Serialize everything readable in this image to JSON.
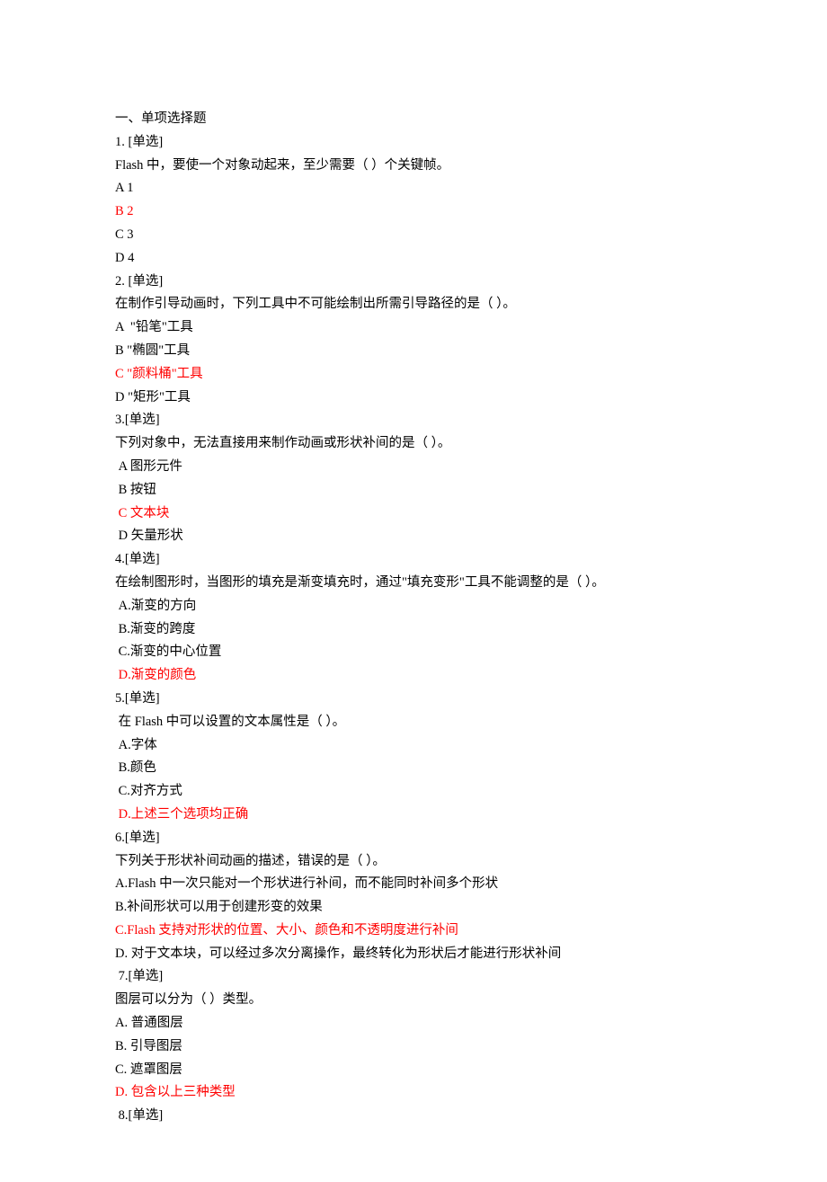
{
  "section_title": "一、单项选择题",
  "q1": {
    "num": "1. [单选]",
    "stem": "Flash 中，要使一个对象动起来，至少需要（ ）个关键帧。",
    "a": "A 1",
    "b": "B 2",
    "c": "C 3",
    "d": "D 4"
  },
  "q2": {
    "num": "2. [单选]",
    "stem": "在制作引导动画时，下列工具中不可能绘制出所需引导路径的是（ ）。",
    "a": "A  \"铅笔\"工具",
    "b": "B \"椭圆\"工具",
    "c": "C \"颜料桶\"工具",
    "d": "D \"矩形\"工具"
  },
  "q3": {
    "num": "3.[单选]",
    "stem": "下列对象中，无法直接用来制作动画或形状补间的是（ ）。",
    "a": " A 图形元件",
    "b": " B 按钮",
    "c": " C 文本块",
    "d": " D 矢量形状"
  },
  "q4": {
    "num": "4.[单选]",
    "stem": "在绘制图形时，当图形的填充是渐变填充时，通过\"填充变形\"工具不能调整的是（ ）。",
    "a": " A.渐变的方向",
    "b": " B.渐变的跨度",
    "c": " C.渐变的中心位置",
    "d": " D.渐变的颜色"
  },
  "q5": {
    "num": "5.[单选]",
    "stem": " 在 Flash 中可以设置的文本属性是（ ）。",
    "a": " A.字体",
    "b": " B.颜色",
    "c": " C.对齐方式",
    "d": " D.上述三个选项均正确"
  },
  "q6": {
    "num": "6.[单选]",
    "stem": "下列关于形状补间动画的描述，错误的是（ ）。",
    "a": "A.Flash 中一次只能对一个形状进行补间，而不能同时补间多个形状",
    "b": "B.补间形状可以用于创建形变的效果",
    "c": "C.Flash 支持对形状的位置、大小、颜色和不透明度进行补间",
    "d": "D. 对于文本块，可以经过多次分离操作，最终转化为形状后才能进行形状补间"
  },
  "q7": {
    "num": " 7.[单选]",
    "stem": "图层可以分为（ ）类型。",
    "a": "A. 普通图层",
    "b": "B. 引导图层",
    "c": "C. 遮罩图层",
    "d": "D. 包含以上三种类型"
  },
  "q8": {
    "num": " 8.[单选]"
  }
}
